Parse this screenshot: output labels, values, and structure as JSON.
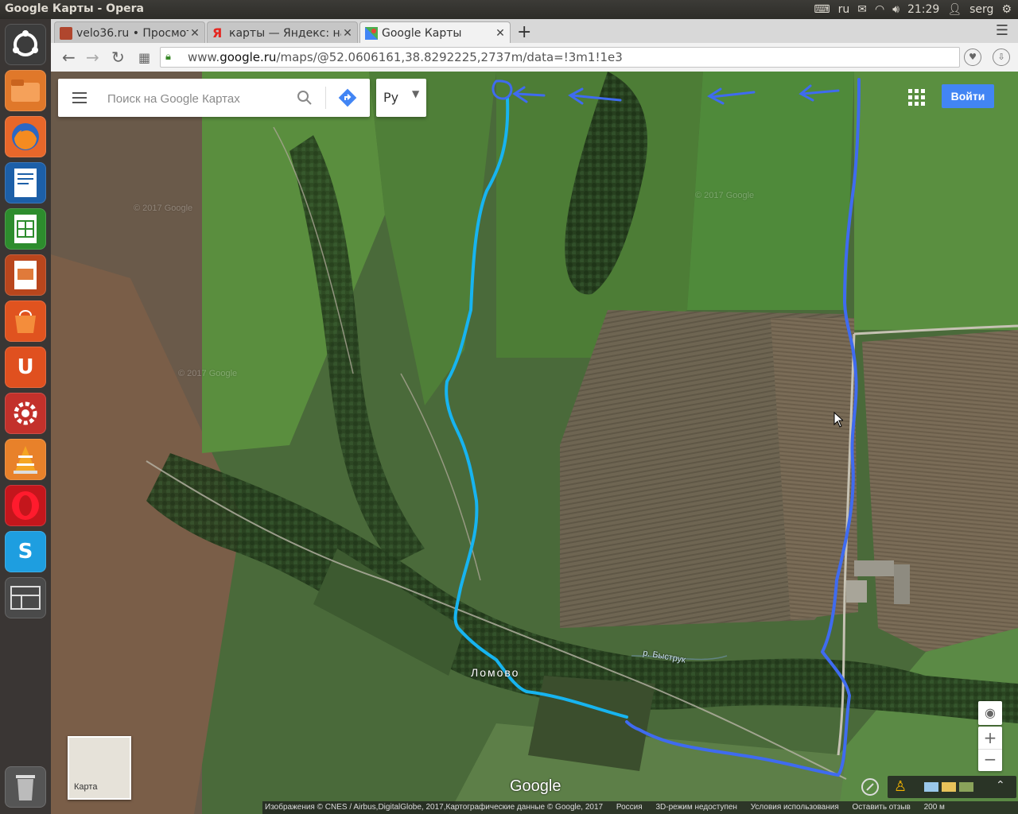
{
  "window": {
    "title": "Google Карты - Opera"
  },
  "tray": {
    "keyboard": "ru",
    "time": "21:29",
    "user": "serg"
  },
  "tabs": [
    {
      "label": "velo36.ru • Просмотр",
      "active": false
    },
    {
      "label": "карты — Яндекс: наш",
      "active": false
    },
    {
      "label": "Google Карты",
      "active": true
    }
  ],
  "address": {
    "domain_prefix": "www.",
    "domain": "google.ru",
    "path": "/maps/@52.0606161,38.8292225,2737m/data=!3m1!1e3"
  },
  "search": {
    "placeholder": "Поиск на Google Картах"
  },
  "language": {
    "label": "Ру"
  },
  "signin": {
    "label": "Войти"
  },
  "minimap": {
    "label": "Карта"
  },
  "map": {
    "village_label": "Ломово",
    "river_label": "р. Быструк",
    "google_logo": "Google",
    "watermark": "© 2017 Google"
  },
  "footer": {
    "attribution": "Изображения © CNES / Airbus,DigitalGlobe, 2017,Картографические данные © Google, 2017",
    "country": "Россия",
    "mode": "3D-режим недоступен",
    "terms": "Условия использования",
    "feedback": "Оставить отзыв",
    "scale": "200 м"
  },
  "colors": {
    "route_light": "#17b4f0",
    "route_dark": "#3f6bf0",
    "signin": "#4285f4"
  }
}
